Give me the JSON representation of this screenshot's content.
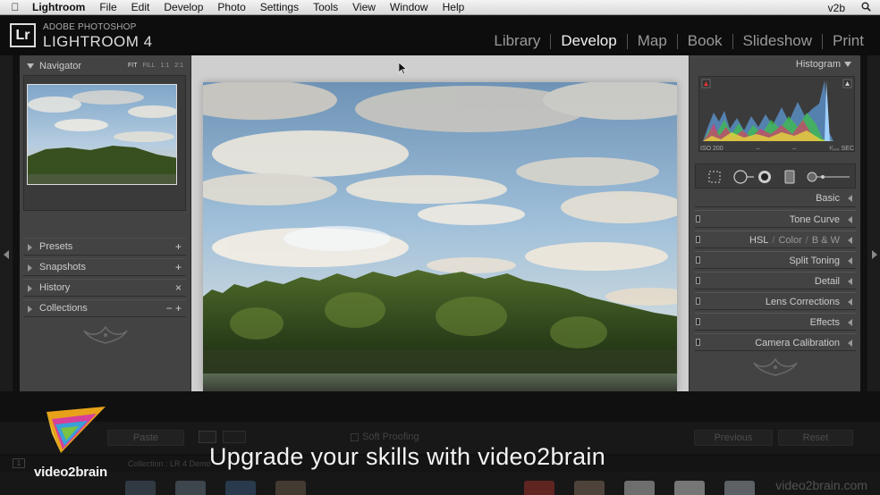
{
  "menubar": {
    "app_name": "Lightroom",
    "items": [
      "File",
      "Edit",
      "Develop",
      "Photo",
      "Settings",
      "Tools",
      "View",
      "Window",
      "Help"
    ],
    "user": "v2b"
  },
  "header": {
    "brand_line1": "ADOBE PHOTOSHOP",
    "brand_line2": "LIGHTROOM 4",
    "logo": "Lr",
    "modules": [
      "Library",
      "Develop",
      "Map",
      "Book",
      "Slideshow",
      "Print"
    ],
    "active_module": "Develop"
  },
  "left_panel": {
    "navigator": {
      "title": "Navigator",
      "zoom_options": [
        "FIT",
        "FILL",
        "1:1",
        "2:1"
      ],
      "active_zoom": "FIT"
    },
    "sections": [
      {
        "label": "Presets",
        "action": "+"
      },
      {
        "label": "Snapshots",
        "action": "+"
      },
      {
        "label": "History",
        "action": "×"
      },
      {
        "label": "Collections",
        "action": "− +"
      }
    ]
  },
  "right_panel": {
    "histogram_title": "Histogram",
    "iso": "ISO 200",
    "shutter": "¹⁄₁₀₀ SEC",
    "dash1": "–",
    "dash2": "–",
    "sections": {
      "basic": "Basic",
      "tone_curve": "Tone Curve",
      "hsl": "HSL",
      "color": "Color",
      "bw": "B & W",
      "split_toning": "Split Toning",
      "detail": "Detail",
      "lens_corrections": "Lens Corrections",
      "effects": "Effects",
      "camera_calibration": "Camera Calibration"
    }
  },
  "toolbar": {
    "soft_proofing": "Soft Proofing",
    "paste": "Paste",
    "previous": "Previous",
    "reset": "Reset"
  },
  "filmstrip": {
    "page": "1",
    "path": "Collection : LR 4 Demo"
  },
  "overlay": {
    "tagline": "Upgrade your skills with video2brain",
    "logo_text": "video2brain",
    "watermark": "video2brain.com"
  },
  "colors": {
    "accent_active": "#f1f1f1",
    "panel_bg": "#434343",
    "center_bg": "#cfcfcf"
  }
}
